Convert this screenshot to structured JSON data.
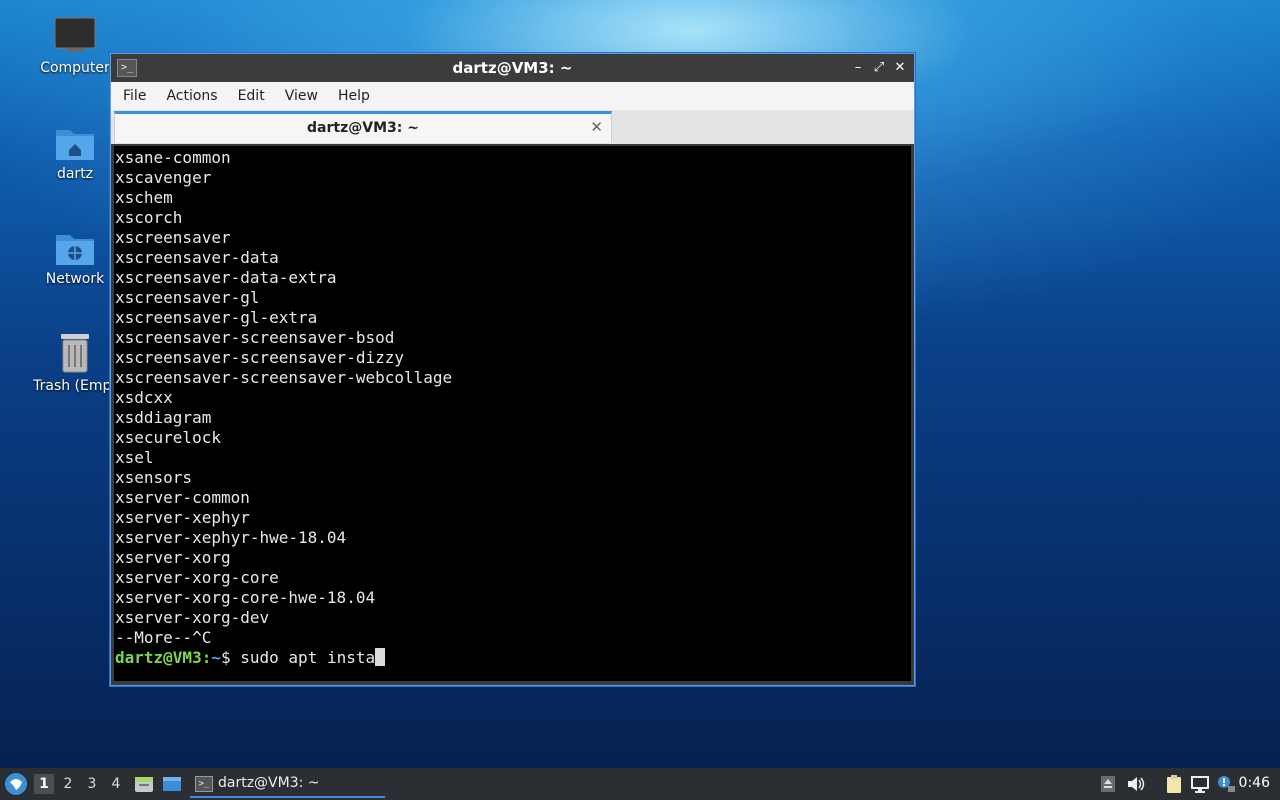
{
  "desktop": {
    "icons": [
      {
        "label": "Computer",
        "icon": "monitor-icon"
      },
      {
        "label": "dartz",
        "icon": "home-folder-icon"
      },
      {
        "label": "Network",
        "icon": "network-folder-icon"
      },
      {
        "label": "Trash (Empt",
        "icon": "trash-icon"
      }
    ]
  },
  "window": {
    "title": "dartz@VM3: ~",
    "app_icon_glyph": ">_",
    "controls": {
      "minimize": "–",
      "maximize": "⤢",
      "close": "✕"
    },
    "menu": [
      "File",
      "Actions",
      "Edit",
      "View",
      "Help"
    ],
    "tab": {
      "title": "dartz@VM3: ~",
      "close": "✕"
    }
  },
  "terminal": {
    "lines": [
      "xsane-common",
      "xscavenger",
      "xschem",
      "xscorch",
      "xscreensaver",
      "xscreensaver-data",
      "xscreensaver-data-extra",
      "xscreensaver-gl",
      "xscreensaver-gl-extra",
      "xscreensaver-screensaver-bsod",
      "xscreensaver-screensaver-dizzy",
      "xscreensaver-screensaver-webcollage",
      "xsdcxx",
      "xsddiagram",
      "xsecurelock",
      "xsel",
      "xsensors",
      "xserver-common",
      "xserver-xephyr",
      "xserver-xephyr-hwe-18.04",
      "xserver-xorg",
      "xserver-xorg-core",
      "xserver-xorg-core-hwe-18.04",
      "xserver-xorg-dev",
      "--More--^C"
    ],
    "prompt": {
      "user_host": "dartz@VM3",
      "separator": ":",
      "path": "~",
      "symbol": "$",
      "command": " sudo apt insta"
    },
    "colors": {
      "user": "#7cd64b",
      "path": "#5d9bef",
      "background": "#000000",
      "text": "#e8e8e8"
    }
  },
  "taskbar": {
    "workspaces": [
      "1",
      "2",
      "3",
      "4"
    ],
    "active_workspace": "1",
    "launchers": [
      "file-manager-icon",
      "show-desktop-icon"
    ],
    "task": {
      "label": "dartz@VM3: ~",
      "icon": "terminal-icon"
    },
    "tray": [
      "upload-icon",
      "volume-icon",
      "clipboard-icon",
      "network-icon",
      "notification-icon"
    ],
    "clock": "0:46"
  }
}
